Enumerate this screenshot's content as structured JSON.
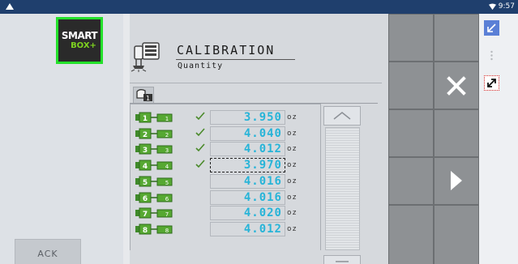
{
  "statusbar": {
    "time": "9:57",
    "left_icon": "notification-icon",
    "wifi_icon": "wifi-icon"
  },
  "logo": {
    "line1": "SMART",
    "line2": "BOX+"
  },
  "ack_label": "ACK",
  "header": {
    "title": "CALIBRATION",
    "subtitle": "Quantity",
    "icon": "sprayer-calibration-icon"
  },
  "tab": {
    "icon": "machine-section-icon"
  },
  "unit": "oz",
  "sections": [
    {
      "section": "1",
      "value": "3.950",
      "checked": true,
      "selected": false
    },
    {
      "section": "2",
      "value": "4.040",
      "checked": true,
      "selected": false
    },
    {
      "section": "3",
      "value": "4.012",
      "checked": true,
      "selected": false
    },
    {
      "section": "4",
      "value": "3.970",
      "checked": true,
      "selected": true
    },
    {
      "section": "5",
      "value": "4.016",
      "checked": false,
      "selected": false
    },
    {
      "section": "6",
      "value": "4.016",
      "checked": false,
      "selected": false
    },
    {
      "section": "7",
      "value": "4.020",
      "checked": false,
      "selected": false
    },
    {
      "section": "8",
      "value": "4.012",
      "checked": false,
      "selected": false
    }
  ],
  "grid_buttons": {
    "close": "close-icon",
    "next": "play-next-icon"
  },
  "strip": {
    "minimize": "minimize-arrow-icon",
    "more": "more-dots-icon",
    "expand": "expand-arrow-icon"
  },
  "colors": {
    "value_text": "#27b4d8",
    "status_bar": "#1f3f6d",
    "logo_border": "#24e12b",
    "accent_green": "#7ed320"
  }
}
